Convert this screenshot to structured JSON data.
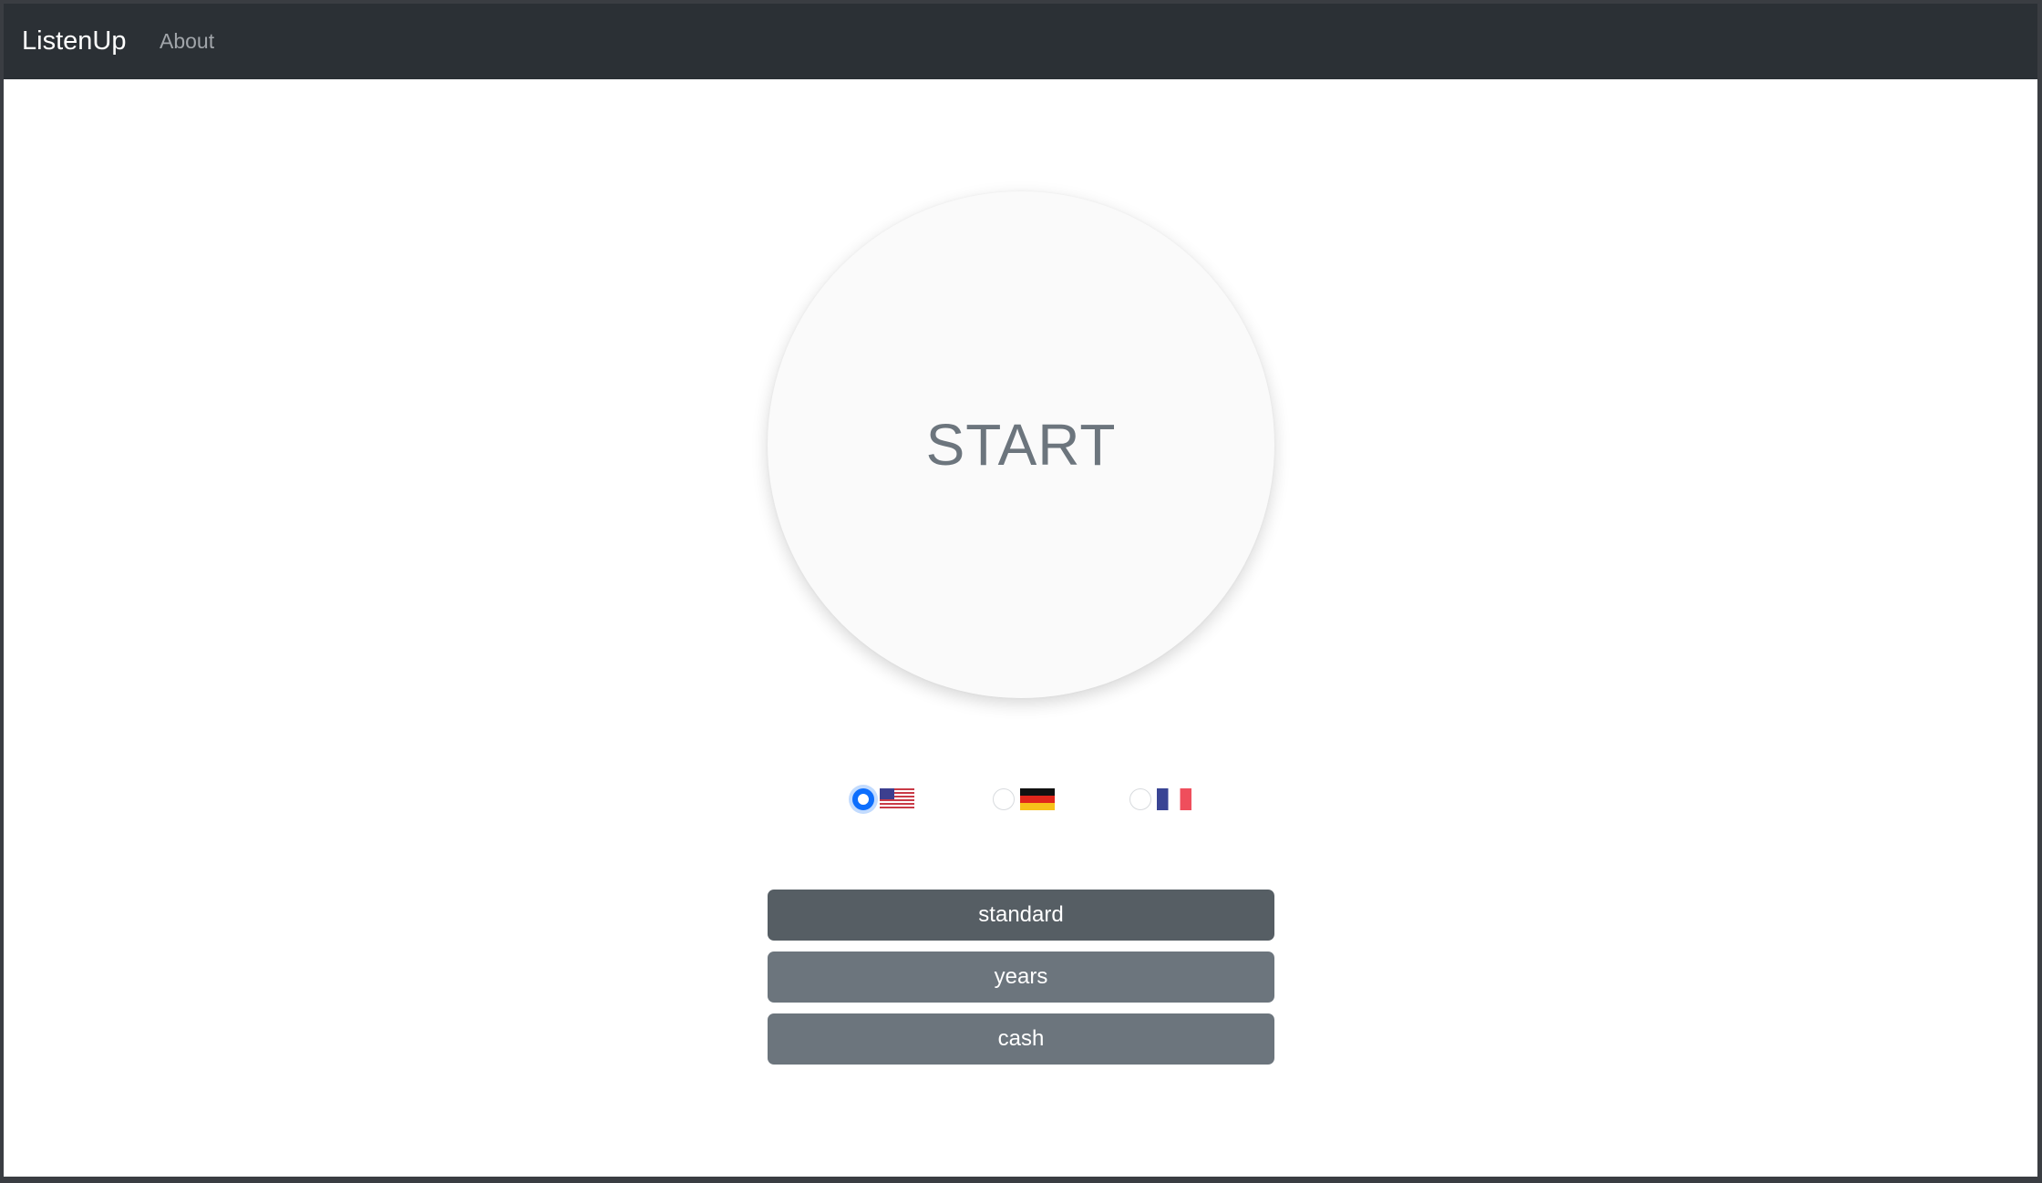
{
  "navbar": {
    "brand": "ListenUp",
    "links": [
      {
        "label": "About"
      }
    ]
  },
  "main": {
    "start_label": "START",
    "languages": [
      {
        "code": "en-US",
        "flag": "us-flag-icon",
        "selected": true
      },
      {
        "code": "de",
        "flag": "de-flag-icon",
        "selected": false
      },
      {
        "code": "fr",
        "flag": "fr-flag-icon",
        "selected": false
      }
    ],
    "modes": [
      {
        "label": "standard",
        "active": true
      },
      {
        "label": "years",
        "active": false
      },
      {
        "label": "cash",
        "active": false
      }
    ]
  },
  "colors": {
    "navbar_bg": "#2b3035",
    "radio_selected": "#0d6efd",
    "button_active": "#565e64",
    "button_inactive": "#6c757d"
  }
}
